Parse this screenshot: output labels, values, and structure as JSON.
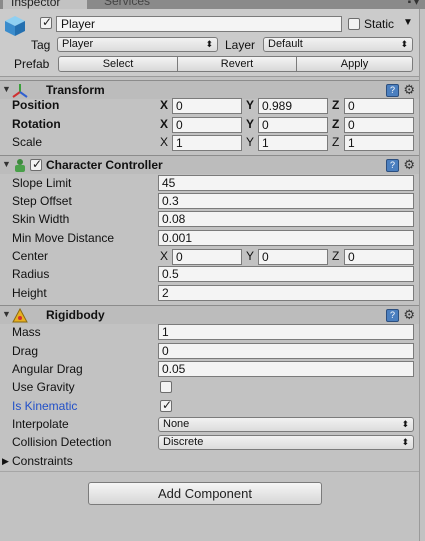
{
  "tabs": {
    "inspector": "Inspector",
    "services": "Services"
  },
  "header": {
    "object_name": "Player",
    "static_label": "Static",
    "tag_label": "Tag",
    "tag_value": "Player",
    "layer_label": "Layer",
    "layer_value": "Default",
    "prefab_label": "Prefab",
    "select": "Select",
    "revert": "Revert",
    "apply": "Apply"
  },
  "transform": {
    "title": "Transform",
    "position": {
      "label": "Position",
      "x": "0",
      "y": "0.989",
      "z": "0"
    },
    "rotation": {
      "label": "Rotation",
      "x": "0",
      "y": "0",
      "z": "0"
    },
    "scale": {
      "label": "Scale",
      "x": "1",
      "y": "1",
      "z": "1"
    }
  },
  "character_controller": {
    "title": "Character Controller",
    "slope_limit": {
      "label": "Slope Limit",
      "value": "45"
    },
    "step_offset": {
      "label": "Step Offset",
      "value": "0.3"
    },
    "skin_width": {
      "label": "Skin Width",
      "value": "0.08"
    },
    "min_move": {
      "label": "Min Move Distance",
      "value": "0.001"
    },
    "center": {
      "label": "Center",
      "x": "0",
      "y": "0",
      "z": "0"
    },
    "radius": {
      "label": "Radius",
      "value": "0.5"
    },
    "height": {
      "label": "Height",
      "value": "2"
    }
  },
  "rigidbody": {
    "title": "Rigidbody",
    "mass": {
      "label": "Mass",
      "value": "1"
    },
    "drag": {
      "label": "Drag",
      "value": "0"
    },
    "angular_drag": {
      "label": "Angular Drag",
      "value": "0.05"
    },
    "use_gravity": {
      "label": "Use Gravity",
      "checked": false
    },
    "is_kinematic": {
      "label": "Is Kinematic",
      "checked": true
    },
    "interpolate": {
      "label": "Interpolate",
      "value": "None"
    },
    "collision": {
      "label": "Collision Detection",
      "value": "Discrete"
    },
    "constraints": {
      "label": "Constraints"
    }
  },
  "axes": {
    "x": "X",
    "y": "Y",
    "z": "Z"
  },
  "add_component": "Add Component",
  "colors": {
    "kinematic_label": "#2250c8",
    "help_icon": "#4b7fbf"
  }
}
